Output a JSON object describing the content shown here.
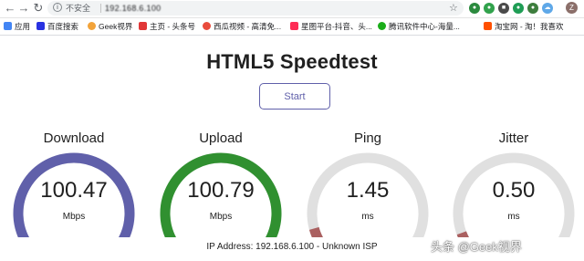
{
  "browser": {
    "security_label": "不安全",
    "url": "192.168.6.100",
    "profile_initial": "Z"
  },
  "bookmarks": [
    {
      "label": "应用",
      "color": "#4285f4"
    },
    {
      "label": "百度搜索",
      "color": "#2932e1"
    },
    {
      "label": "Geek视界",
      "color": "#f2a33a"
    },
    {
      "label": "主页 - 头条号",
      "color": "#e13737"
    },
    {
      "label": "西瓜视频 - 高清免...",
      "color": "#e94b3c"
    },
    {
      "label": "星图平台-抖音、头...",
      "color": "#fe2c55"
    },
    {
      "label": "腾讯软件中心-海量...",
      "color": "#1aad19"
    },
    {
      "label": "淘宝网 - 淘！我喜欢",
      "color": "#ff5000"
    }
  ],
  "page": {
    "title": "HTML5 Speedtest",
    "start_label": "Start",
    "ip_text": "IP Address: 192.168.6.100 - Unknown ISP"
  },
  "gauges": [
    {
      "label": "Download",
      "value": "100.47",
      "unit": "Mbps",
      "fill_fraction": 1.0,
      "color": "#6060aa"
    },
    {
      "label": "Upload",
      "value": "100.79",
      "unit": "Mbps",
      "fill_fraction": 1.0,
      "color": "#309030"
    },
    {
      "label": "Ping",
      "value": "1.45",
      "unit": "ms",
      "fill_fraction": 0.06,
      "color": "#aa6060"
    },
    {
      "label": "Jitter",
      "value": "0.50",
      "unit": "ms",
      "fill_fraction": 0.04,
      "color": "#aa6060"
    }
  ],
  "watermark": "头条 @Geek视界",
  "colors": {
    "track": "#e0e0e0",
    "text": "#202020",
    "accent": "#6060aa"
  }
}
